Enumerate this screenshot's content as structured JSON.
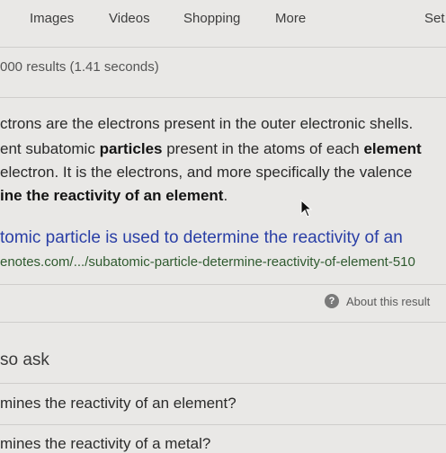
{
  "tabs": [
    {
      "label": "Images"
    },
    {
      "label": "Videos"
    },
    {
      "label": "Shopping"
    },
    {
      "label": "More"
    },
    {
      "label": "Set"
    }
  ],
  "result_stats": "000 results (1.41 seconds)",
  "snippet": {
    "line1": "ctrons are the electrons present in the outer electronic shells.",
    "line2_a": "ent subatomic ",
    "line2_b": "particles",
    "line2_c": " present in the atoms of each ",
    "line2_d": "element",
    "line3": "electron. It is the electrons, and more specifically the valence",
    "line4_a": "ine the reactivity of an element",
    "line4_b": "."
  },
  "result": {
    "title": "tomic particle is used to determine the reactivity of an",
    "url": "enotes.com/.../subatomic-particle-determine-reactivity-of-element-510"
  },
  "about": {
    "icon": "help-circle-icon",
    "label": "About this result"
  },
  "people_also_ask": {
    "title": "so ask",
    "questions": [
      "mines the reactivity of an element?",
      "mines the reactivity of a metal?"
    ]
  }
}
